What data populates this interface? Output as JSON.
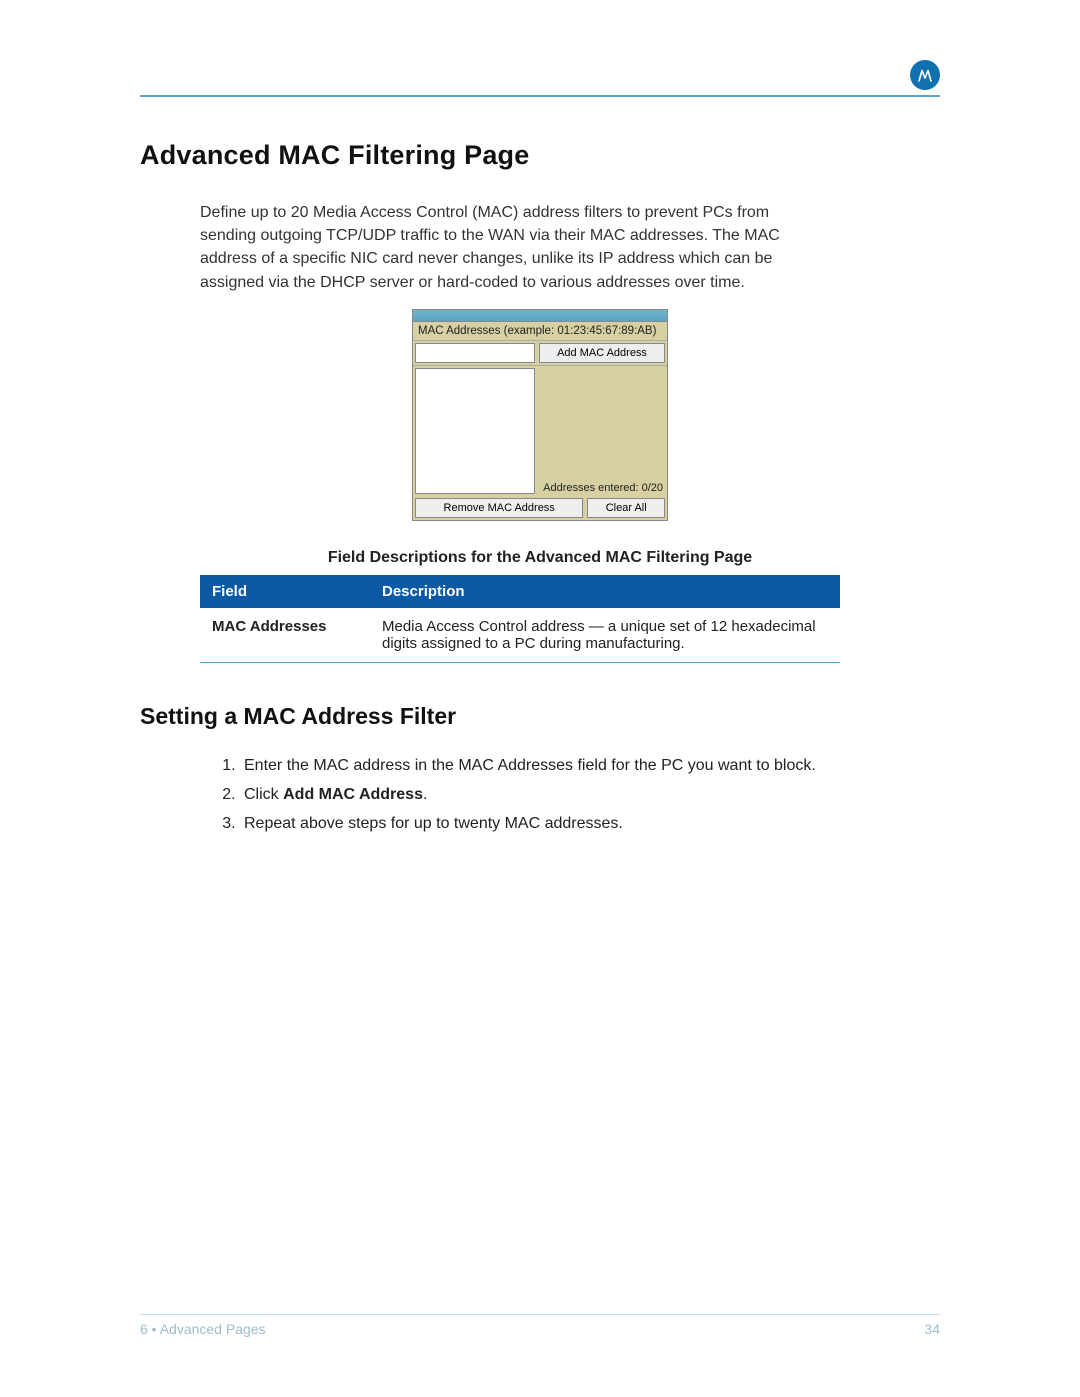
{
  "header": {
    "logo_name": "motorola-logo"
  },
  "title": "Advanced MAC Filtering Page",
  "intro": "Define up to 20 Media Access Control (MAC) address filters to prevent PCs from sending outgoing TCP/UDP traffic to the WAN via their MAC addresses. The MAC address of a specific NIC card never changes, unlike its IP address which can be assigned via the DHCP server or hard-coded to various addresses over time.",
  "panel": {
    "example_label": "MAC Addresses (example: 01:23:45:67:89:AB)",
    "mac_input_value": "",
    "add_btn": "Add MAC Address",
    "counter": "Addresses entered: 0/20",
    "remove_btn": "Remove MAC Address",
    "clear_btn": "Clear All"
  },
  "table": {
    "caption": "Field Descriptions for the Advanced MAC Filtering Page",
    "headers": {
      "field": "Field",
      "description": "Description"
    },
    "rows": [
      {
        "field": "MAC Addresses",
        "description": "Media Access Control address — a unique set of 12 hexadecimal digits assigned to a PC during manufacturing."
      }
    ]
  },
  "subhead": "Setting a MAC Address Filter",
  "steps": [
    {
      "pre": "Enter the MAC address in the MAC Addresses field for the PC you want to block.",
      "bold": "",
      "post": ""
    },
    {
      "pre": "Click ",
      "bold": "Add MAC Address",
      "post": "."
    },
    {
      "pre": "Repeat above steps for up to twenty MAC addresses.",
      "bold": "",
      "post": ""
    }
  ],
  "footer": {
    "left": "6 • Advanced Pages",
    "right": "34"
  }
}
